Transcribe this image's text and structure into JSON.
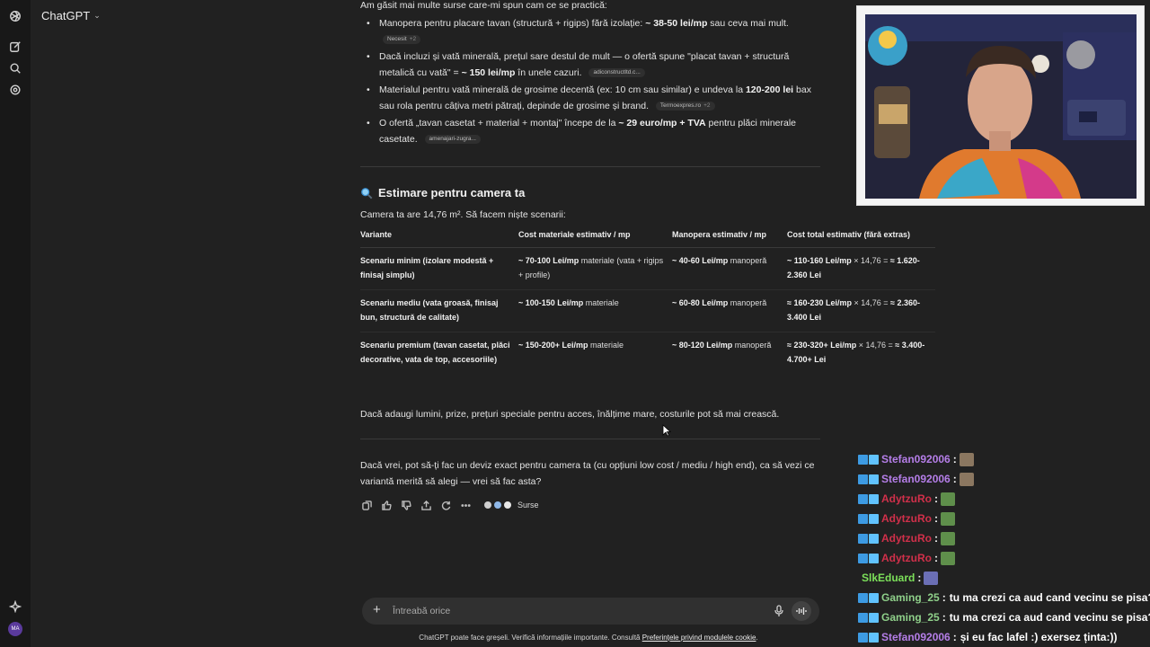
{
  "app": {
    "model_label": "ChatGPT"
  },
  "answer": {
    "intro": "Am găsit mai multe surse care-mi spun cam ce se practică:",
    "bullets": [
      {
        "pre": "Manopera pentru placare tavan (structură + rigips) fără izolație: ",
        "bold": "~ 38-50 lei/mp",
        "post": " sau ceva mai mult.",
        "src": "Necesit",
        "more": "+2"
      },
      {
        "pre": "Dacă incluzi și vată minerală, prețul sare destul de mult — o ofertă spune \"placat tavan + structură metalică cu vată\" = ",
        "bold": "~ 150 lei/mp",
        "post": " în unele cazuri.",
        "src": "adiconstructltd.c...",
        "more": ""
      },
      {
        "pre": "Materialul pentru vată minerală de grosime decentă (ex: 10 cm sau similar) e undeva la ",
        "bold": "120-200 lei",
        "post": " bax sau rola pentru câțiva metri pătrați, depinde de grosime și brand.",
        "src": "Termoexpres.ro",
        "more": "+2"
      },
      {
        "pre": "O ofertă „tavan casetat + material + montaj\" începe de la ",
        "bold": "~ 29 euro/mp + TVA",
        "post": " pentru plăci minerale casetate.",
        "src": "amenajari-zugra...",
        "more": ""
      }
    ],
    "heading": "Estimare pentru camera ta",
    "room_text": "Camera ta are 14,76 m². Să facem niște scenarii:",
    "table": {
      "headers": [
        "Variante",
        "Cost materiale estimativ / mp",
        "Manopera estimativ / mp",
        "Cost total estimativ (fără extras)"
      ],
      "rows": [
        {
          "variant": "Scenariu minim (izolare modestă + finisaj simplu)",
          "mat_bold": "~ 70-100 Lei/mp",
          "mat_rest": " materiale (vata + rigips + profile)",
          "lab_bold": "~ 40-60 Lei/mp",
          "lab_rest": " manoperă",
          "tot_bold": "~ 110-160 Lei/mp",
          "tot_mid": " × 14,76 = ",
          "tot_end": "≈ 1.620-2.360 Lei"
        },
        {
          "variant": "Scenariu mediu (vata groasă, finisaj bun, structură de calitate)",
          "mat_bold": "~ 100-150 Lei/mp",
          "mat_rest": " materiale",
          "lab_bold": "~ 60-80 Lei/mp",
          "lab_rest": " manoperă",
          "tot_bold": "≈ 160-230 Lei/mp",
          "tot_mid": " × 14,76 = ",
          "tot_end": "≈ 2.360-3.400 Lei"
        },
        {
          "variant": "Scenariu premium (tavan casetat, plăci decorative, vata de top, accesoriile)",
          "mat_bold": "~ 150-200+ Lei/mp",
          "mat_rest": " materiale",
          "lab_bold": "~ 80-120 Lei/mp",
          "lab_rest": " manoperă",
          "tot_bold": "≈ 230-320+ Lei/mp",
          "tot_mid": " × 14,76 = ",
          "tot_end": "≈ 3.400-4.700+ Lei"
        }
      ]
    },
    "extras_note": "Dacă adaugi lumini, prize, prețuri speciale pentru acces, înălțime mare, costurile pot să mai crească.",
    "offer": "Dacă vrei, pot să-ți fac un deviz exact pentru camera ta (cu opțiuni low cost / mediu / high end), ca să vezi ce variantă merită să alegi — vrei să fac asta?",
    "sources_label": "Surse"
  },
  "composer": {
    "placeholder": "Întreabă orice"
  },
  "disclaimer": {
    "text": "ChatGPT poate face greșeli. Verifică informațiile importante. Consultă ",
    "link": "Preferințele privind modulele cookie",
    "end": "."
  },
  "user": {
    "initials": "MA"
  },
  "chat": [
    {
      "user": "Stefan092006",
      "color": "#b57ee8",
      "message": "",
      "emote": "cat"
    },
    {
      "user": "Stefan092006",
      "color": "#b57ee8",
      "message": "",
      "emote": "cat"
    },
    {
      "user": "AdytzuRo",
      "color": "#d0304a",
      "message": "",
      "emote": "frog"
    },
    {
      "user": "AdytzuRo",
      "color": "#d0304a",
      "message": "",
      "emote": "frog"
    },
    {
      "user": "AdytzuRo",
      "color": "#d0304a",
      "message": "",
      "emote": "frog"
    },
    {
      "user": "AdytzuRo",
      "color": "#d0304a",
      "message": "",
      "emote": "frog"
    },
    {
      "user": "SlkEduard",
      "color": "#7ce05a",
      "message": "",
      "emote": "box"
    },
    {
      "user": "Gaming_25",
      "color": "#8fd08a",
      "message": "tu ma crezi ca aud cand vecinu se pisa?",
      "emote": ""
    },
    {
      "user": "Gaming_25",
      "color": "#8fd08a",
      "message": "tu ma crezi ca aud cand vecinu se pisa?",
      "emote": ""
    },
    {
      "user": "Stefan092006",
      "color": "#b57ee8",
      "message": "și eu fac lafel :) exersez ținta:))",
      "emote": ""
    }
  ]
}
